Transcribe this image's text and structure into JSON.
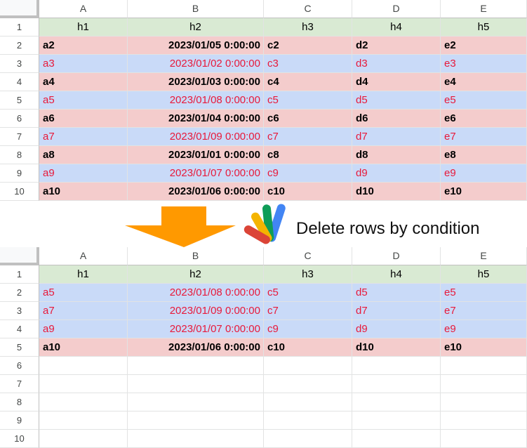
{
  "colors": {
    "header_fill": "#d9ead3",
    "pink_fill": "#f4cccc",
    "blue_fill": "#c9daf8",
    "red_text": "#e8193a",
    "arrow": "#ff9900",
    "grid": "#e2e3e3"
  },
  "caption": "Delete rows by condition",
  "arrow_icon": "down-arrow-icon",
  "logo_icon": "apps-script-logo-icon",
  "sheet_before": {
    "columns": [
      "A",
      "B",
      "C",
      "D",
      "E"
    ],
    "rows": [
      {
        "num": "1",
        "style": "header",
        "cells": [
          "h1",
          "h2",
          "h3",
          "h4",
          "h5"
        ]
      },
      {
        "num": "2",
        "style": "pink",
        "cells": [
          "a2",
          "2023/01/05 0:00:00",
          "c2",
          "d2",
          "e2"
        ]
      },
      {
        "num": "3",
        "style": "blue",
        "cells": [
          "a3",
          "2023/01/02 0:00:00",
          "c3",
          "d3",
          "e3"
        ]
      },
      {
        "num": "4",
        "style": "pink",
        "cells": [
          "a4",
          "2023/01/03 0:00:00",
          "c4",
          "d4",
          "e4"
        ]
      },
      {
        "num": "5",
        "style": "blue",
        "cells": [
          "a5",
          "2023/01/08 0:00:00",
          "c5",
          "d5",
          "e5"
        ]
      },
      {
        "num": "6",
        "style": "pink",
        "cells": [
          "a6",
          "2023/01/04 0:00:00",
          "c6",
          "d6",
          "e6"
        ]
      },
      {
        "num": "7",
        "style": "blue",
        "cells": [
          "a7",
          "2023/01/09 0:00:00",
          "c7",
          "d7",
          "e7"
        ]
      },
      {
        "num": "8",
        "style": "pink",
        "cells": [
          "a8",
          "2023/01/01 0:00:00",
          "c8",
          "d8",
          "e8"
        ]
      },
      {
        "num": "9",
        "style": "blue",
        "cells": [
          "a9",
          "2023/01/07 0:00:00",
          "c9",
          "d9",
          "e9"
        ]
      },
      {
        "num": "10",
        "style": "pink",
        "cells": [
          "a10",
          "2023/01/06 0:00:00",
          "c10",
          "d10",
          "e10"
        ]
      }
    ]
  },
  "sheet_after": {
    "columns": [
      "A",
      "B",
      "C",
      "D",
      "E"
    ],
    "rows": [
      {
        "num": "1",
        "style": "header",
        "cells": [
          "h1",
          "h2",
          "h3",
          "h4",
          "h5"
        ]
      },
      {
        "num": "2",
        "style": "blue",
        "cells": [
          "a5",
          "2023/01/08 0:00:00",
          "c5",
          "d5",
          "e5"
        ]
      },
      {
        "num": "3",
        "style": "blue",
        "cells": [
          "a7",
          "2023/01/09 0:00:00",
          "c7",
          "d7",
          "e7"
        ]
      },
      {
        "num": "4",
        "style": "blue",
        "cells": [
          "a9",
          "2023/01/07 0:00:00",
          "c9",
          "d9",
          "e9"
        ]
      },
      {
        "num": "5",
        "style": "pink",
        "cells": [
          "a10",
          "2023/01/06 0:00:00",
          "c10",
          "d10",
          "e10"
        ]
      },
      {
        "num": "6",
        "style": "empty",
        "cells": [
          "",
          "",
          "",
          "",
          ""
        ]
      },
      {
        "num": "7",
        "style": "empty",
        "cells": [
          "",
          "",
          "",
          "",
          ""
        ]
      },
      {
        "num": "8",
        "style": "empty",
        "cells": [
          "",
          "",
          "",
          "",
          ""
        ]
      },
      {
        "num": "9",
        "style": "empty",
        "cells": [
          "",
          "",
          "",
          "",
          ""
        ]
      },
      {
        "num": "10",
        "style": "empty",
        "cells": [
          "",
          "",
          "",
          "",
          ""
        ]
      }
    ]
  }
}
